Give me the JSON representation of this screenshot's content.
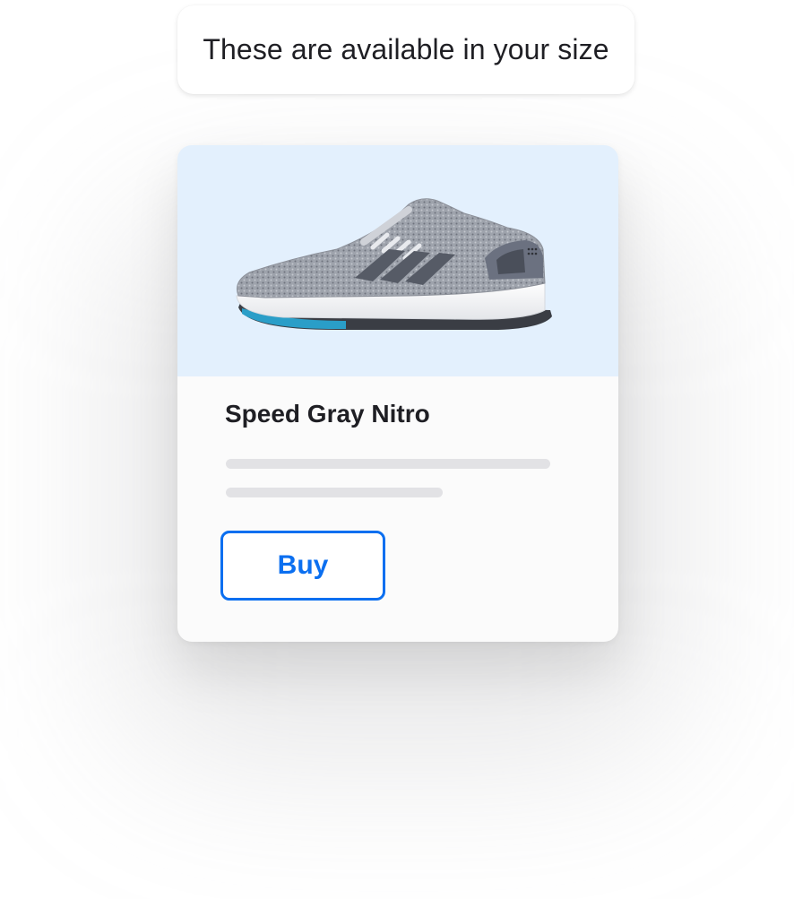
{
  "message": {
    "text": "These are available in your size"
  },
  "product": {
    "name": "Speed Gray Nitro",
    "image_icon": "running-shoe-image",
    "buy_label": "Buy"
  },
  "colors": {
    "accent": "#0b6ff0",
    "image_background": "#e3f0fd",
    "card_background": "#fbfbfb",
    "placeholder_line": "#e2e2e5",
    "text": "#1f1f24"
  }
}
